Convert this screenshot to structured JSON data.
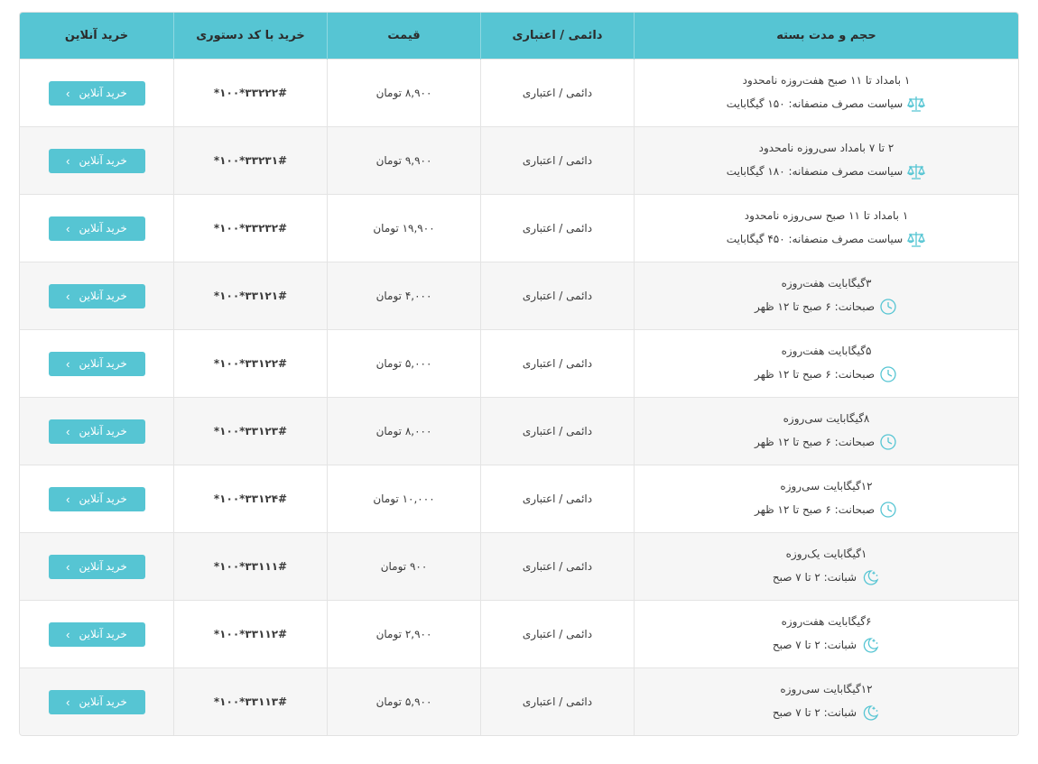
{
  "table": {
    "headers": [
      "حجم و مدت بسته",
      "دائمی / اعتباری",
      "قیمت",
      "خرید با کد دستوری",
      "خرید آنلاین"
    ],
    "rows": [
      {
        "line1": "۱ بامداد تا ۱۱ صبح هفت‌روزه نامحدود",
        "line2": "سیاست مصرف منصفانه: ۱۵۰ گیگابایت",
        "icon": "scale-icon",
        "type": "دائمی / اعتباری",
        "price": "۸,۹۰۰ تومان",
        "code": "*۱۰۰*۳۳۲۲۲#",
        "button": "خرید آنلاین"
      },
      {
        "line1": "۲ تا ۷ بامداد سی‌روزه نامحدود",
        "line2": "سیاست مصرف منصفانه: ۱۸۰ گیگابایت",
        "icon": "scale-icon",
        "type": "دائمی / اعتباری",
        "price": "۹,۹۰۰ تومان",
        "code": "*۱۰۰*۳۳۲۳۱#",
        "button": "خرید آنلاین"
      },
      {
        "line1": "۱ بامداد تا ۱۱ صبح سی‌روزه نامحدود",
        "line2": "سیاست مصرف منصفانه: ۴۵۰ گیگابایت",
        "icon": "scale-icon",
        "type": "دائمی / اعتباری",
        "price": "۱۹,۹۰۰ تومان",
        "code": "*۱۰۰*۳۳۲۳۲#",
        "button": "خرید آنلاین"
      },
      {
        "line1": "۳گیگابایت هفت‌روزه",
        "line2": "صبحانت: ۶ صبح تا ۱۲ ظهر",
        "icon": "clock-icon",
        "type": "دائمی / اعتباری",
        "price": "۴,۰۰۰ تومان",
        "code": "*۱۰۰*۳۳۱۲۱#",
        "button": "خرید آنلاین"
      },
      {
        "line1": "۵گیگابایت هفت‌روزه",
        "line2": "صبحانت: ۶ صبح تا ۱۲ ظهر",
        "icon": "clock-icon",
        "type": "دائمی / اعتباری",
        "price": "۵,۰۰۰ تومان",
        "code": "*۱۰۰*۳۳۱۲۲#",
        "button": "خرید آنلاین"
      },
      {
        "line1": "۸گیگابایت سی‌روزه",
        "line2": "صبحانت: ۶ صبح تا ۱۲ ظهر",
        "icon": "clock-icon",
        "type": "دائمی / اعتباری",
        "price": "۸,۰۰۰ تومان",
        "code": "*۱۰۰*۳۳۱۲۳#",
        "button": "خرید آنلاین"
      },
      {
        "line1": "۱۲گیگابایت سی‌روزه",
        "line2": "صبحانت: ۶ صبح تا ۱۲ ظهر",
        "icon": "clock-icon",
        "type": "دائمی / اعتباری",
        "price": "۱۰,۰۰۰ تومان",
        "code": "*۱۰۰*۳۳۱۲۴#",
        "button": "خرید آنلاین"
      },
      {
        "line1": "۱گیگابایت یک‌روزه",
        "line2": "شبانت: ۲ تا ۷ صبح",
        "icon": "moon-stars-icon",
        "type": "دائمی / اعتباری",
        "price": "۹۰۰ تومان",
        "code": "*۱۰۰*۳۳۱۱۱#",
        "button": "خرید آنلاین"
      },
      {
        "line1": "۶گیگابایت هفت‌روزه",
        "line2": "شبانت: ۲ تا ۷ صبح",
        "icon": "moon-stars-icon",
        "type": "دائمی / اعتباری",
        "price": "۲,۹۰۰ تومان",
        "code": "*۱۰۰*۳۳۱۱۲#",
        "button": "خرید آنلاین"
      },
      {
        "line1": "۱۲گیگابایت سی‌روزه",
        "line2": "شبانت: ۲ تا ۷ صبح",
        "icon": "moon-stars-icon",
        "type": "دائمی / اعتباری",
        "price": "۵,۹۰۰ تومان",
        "code": "*۱۰۰*۳۳۱۱۳#",
        "button": "خرید آنلاین"
      }
    ]
  },
  "colors": {
    "accent": "#56c5d3",
    "icon": "#56c5d3"
  }
}
